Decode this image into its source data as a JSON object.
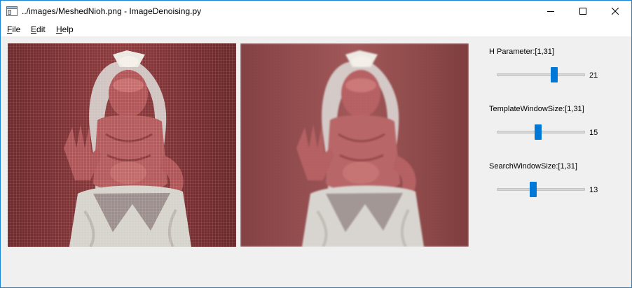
{
  "window": {
    "title": "../images/MeshedNioh.png - ImageDenoising.py"
  },
  "menu": [
    {
      "mnemonic": "F",
      "rest": "ile"
    },
    {
      "mnemonic": "E",
      "rest": "dit"
    },
    {
      "mnemonic": "H",
      "rest": "elp"
    }
  ],
  "params": [
    {
      "label": "H Parameter:[1,31]",
      "value": "21",
      "min": 1,
      "max": 31,
      "current": 21
    },
    {
      "label": "TemplateWindowSize:[1,31]",
      "value": "15",
      "min": 1,
      "max": 31,
      "current": 15
    },
    {
      "label": "SearchWindowSize:[1,31]",
      "value": "13",
      "min": 1,
      "max": 31,
      "current": 13
    }
  ],
  "colors": {
    "accent": "#0078d7",
    "background_red": "#8d3a3a",
    "statue_white": "#d9d6d3",
    "skin_red": "#b75a5c"
  },
  "icons": {
    "app": "window-icon",
    "minimize": "minimize-icon",
    "maximize": "maximize-icon",
    "close": "close-icon"
  }
}
